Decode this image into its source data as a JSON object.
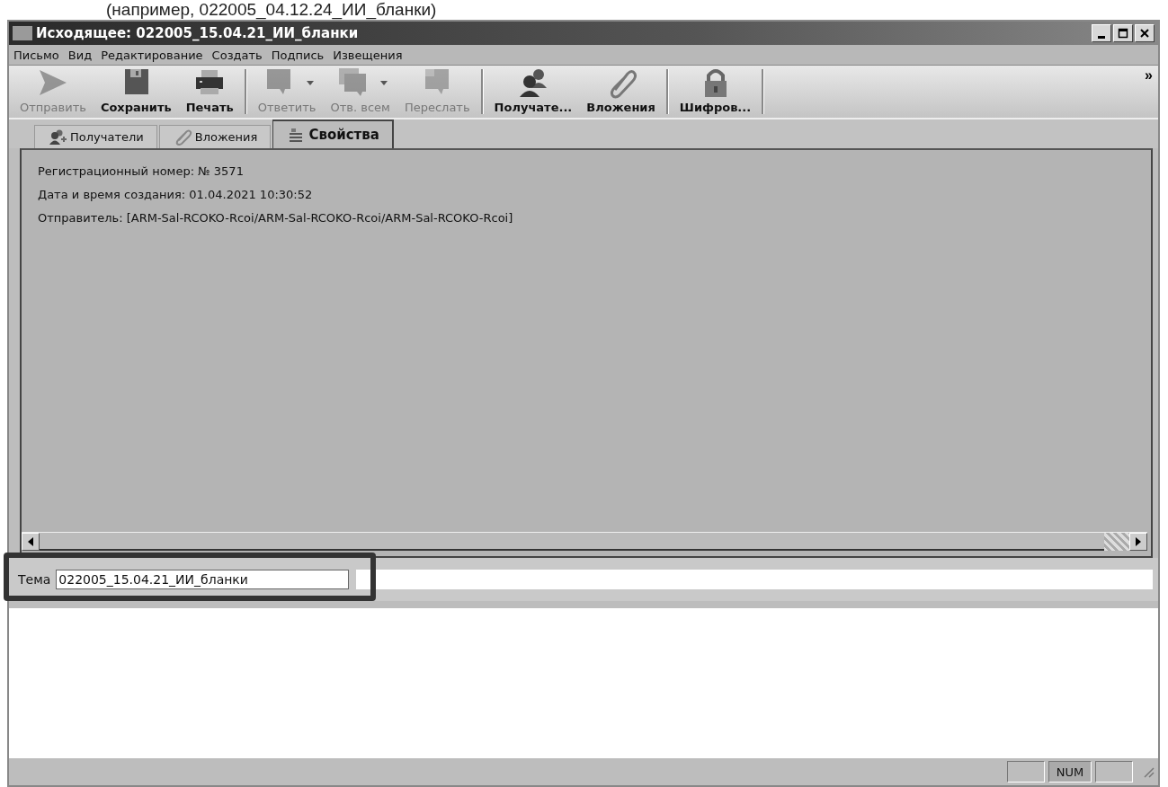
{
  "caption": "(например, 022005_04.12.24_ИИ_бланки)",
  "window": {
    "title": "Исходящее: 022005_15.04.21_ИИ_бланки"
  },
  "menu": [
    "Письмо",
    "Вид",
    "Редактирование",
    "Создать",
    "Подпись",
    "Извещения"
  ],
  "toolbar": {
    "groups": [
      [
        {
          "label": "Отправить",
          "disabled": true,
          "dropdown": false
        },
        {
          "label": "Сохранить",
          "disabled": false,
          "dropdown": false
        },
        {
          "label": "Печать",
          "disabled": false,
          "dropdown": false
        }
      ],
      [
        {
          "label": "Ответить",
          "disabled": true,
          "dropdown": true
        },
        {
          "label": "Отв. всем",
          "disabled": true,
          "dropdown": true
        },
        {
          "label": "Переслать",
          "disabled": true,
          "dropdown": false
        }
      ],
      [
        {
          "label": "Получате...",
          "disabled": false,
          "dropdown": false
        },
        {
          "label": "Вложения",
          "disabled": false,
          "dropdown": false
        }
      ],
      [
        {
          "label": "Шифров...",
          "disabled": false,
          "dropdown": false
        }
      ]
    ],
    "overflow": "»"
  },
  "tabs": [
    {
      "label": "Получатели",
      "selected": false
    },
    {
      "label": "Вложения",
      "selected": false
    },
    {
      "label": "Свойства",
      "selected": true
    }
  ],
  "properties": [
    "Регистрационный номер: № 3571",
    "Дата и время создания: 01.04.2021 10:30:52",
    "Отправитель: [ARM-Sal-RCOKO-Rcoi/ARM-Sal-RCOKO-Rcoi/ARM-Sal-RCOKO-Rcoi]"
  ],
  "subject": {
    "label": "Тема",
    "value": "022005_15.04.21_ИИ_бланки",
    "highlighted": true
  },
  "status_bar": {
    "indicator": "NUM"
  }
}
